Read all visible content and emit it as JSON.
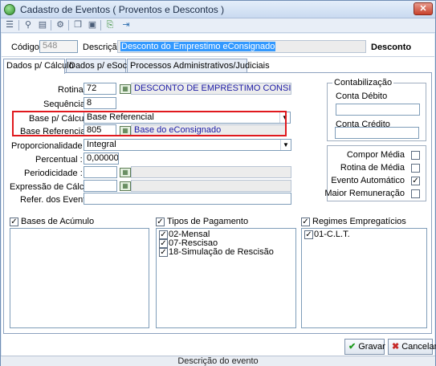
{
  "window": {
    "title": "Cadastro de Eventos ( Proventos e Descontos )",
    "close_glyph": "✕"
  },
  "toolbar": {
    "icons": [
      "list-icon",
      "search-icon",
      "print-icon",
      "settings-icon",
      "copy-icon",
      "paste-icon",
      "export-icon",
      "exit-icon"
    ]
  },
  "header": {
    "codigo_label": "Código :",
    "codigo_value": "548",
    "descricao_label": "Descrição :",
    "descricao_value": "Desconto do Emprestimo eConsignado",
    "tipo": "Desconto"
  },
  "tabs": [
    {
      "label": "Dados p/ Cálculo",
      "active": true
    },
    {
      "label": "Dados p/ eSocial",
      "active": false
    },
    {
      "label": "Processos Administrativos/Judiciais",
      "active": false
    }
  ],
  "form": {
    "rotina_label": "Rotina :",
    "rotina_value": "72",
    "rotina_desc": "DESCONTO DE EMPRÉSTIMO CONSIGNADO",
    "sequencia_label": "Sequência :",
    "sequencia_value": "8",
    "base_calculo_label": "Base p/ Cálculo :",
    "base_calculo_value": "Base Referencial",
    "base_referencial_label": "Base Referencial :",
    "base_referencial_value": "805",
    "base_referencial_desc": "Base do eConsignado",
    "proporcionalidade_label": "Proporcionalidade :",
    "proporcionalidade_value": "Integral",
    "percentual_label": "Percentual :",
    "percentual_value": "0,000000",
    "periodicidade_label": "Periodicidade :",
    "expressao_label": "Expressão de Cálculo :",
    "refer_label": "Refer. dos Eventos :"
  },
  "contabilizacao": {
    "title": "Contabilização",
    "debito_label": "Conta Débito",
    "credito_label": "Conta Crédito"
  },
  "options": [
    {
      "label": "Compor Média",
      "checked": false
    },
    {
      "label": "Rotina de Média",
      "checked": false
    },
    {
      "label": "Evento Automático",
      "checked": true
    },
    {
      "label": "Maior Remuneração",
      "checked": false
    }
  ],
  "bases_acumulo": {
    "title": "Bases de Acúmulo",
    "checked": true,
    "items": []
  },
  "tipos_pagamento": {
    "title": "Tipos de Pagamento",
    "checked": true,
    "items": [
      {
        "label": "02-Mensal",
        "checked": true
      },
      {
        "label": "07-Rescisao",
        "checked": true
      },
      {
        "label": "18-Simulação de Rescisão",
        "checked": true
      }
    ]
  },
  "regimes": {
    "title": "Regimes Empregatícios",
    "checked": true,
    "items": [
      {
        "label": "01-C.L.T.",
        "checked": true
      }
    ]
  },
  "buttons": {
    "gravar": "Gravar",
    "cancelar": "Cancelar"
  },
  "status": {
    "text": "Descrição do evento"
  }
}
